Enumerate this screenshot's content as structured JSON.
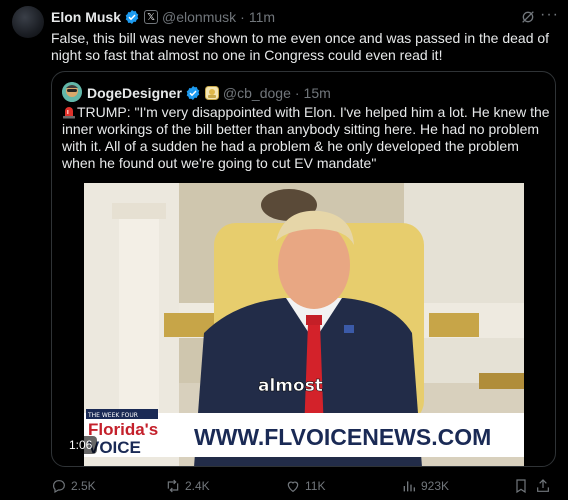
{
  "tweet": {
    "author_name": "Elon Musk",
    "handle": "@elonmusk",
    "time": "11m",
    "text": "False, this bill was never shown to me even once and was passed in the dead of night so fast that almost no one in Congress could even read it!"
  },
  "quote": {
    "author_name": "DogeDesigner",
    "handle": "@cb_doge",
    "time": "15m",
    "text": "TRUMP: \"I'm very disappointed with Elon. I've helped him a lot. He knew the inner workings of the bill better than anybody sitting here. He had no problem with it. All of a sudden he had a problem & he only developed the problem when he found out we're going to cut EV mandate\"",
    "video": {
      "caption": "almost",
      "banner_brand_small": "THE WEEK FOUR",
      "banner_brand_line1": "Florida's",
      "banner_brand_line2": "VOICE",
      "banner_url": "WWW.FLVOICENEWS.COM",
      "duration": "1:06"
    }
  },
  "actions": {
    "replies": "2.5K",
    "reposts": "2.4K",
    "likes": "11K",
    "views": "923K"
  },
  "colors": {
    "background": "#000000",
    "text": "#e7e9ea",
    "muted": "#71767b",
    "verified": "#1d9bf0",
    "border": "#2f3336"
  }
}
